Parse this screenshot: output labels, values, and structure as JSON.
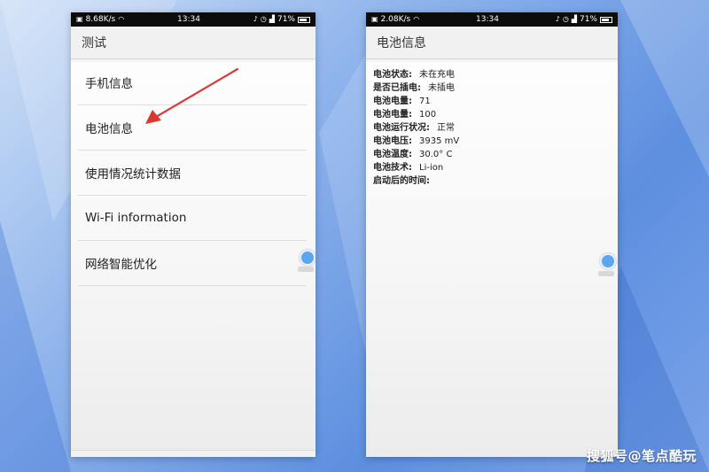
{
  "left_phone": {
    "status": {
      "speed": "8.68K/s",
      "time": "13:34",
      "battery": "71%"
    },
    "title": "测试",
    "menu": [
      {
        "label": "手机信息"
      },
      {
        "label": "电池信息"
      },
      {
        "label": "使用情况统计数据"
      },
      {
        "label": "Wi-Fi information"
      },
      {
        "label": "网络智能优化"
      }
    ]
  },
  "right_phone": {
    "status": {
      "speed": "2.08K/s",
      "time": "13:34",
      "battery": "71%"
    },
    "title": "电池信息",
    "info": [
      {
        "key": "电池状态:",
        "value": "未在充电"
      },
      {
        "key": "是否已插电:",
        "value": "未插电"
      },
      {
        "key": "电池电量:",
        "value": "71"
      },
      {
        "key": "电池电量:",
        "value": "100"
      },
      {
        "key": "电池运行状况:",
        "value": "正常"
      },
      {
        "key": "电池电压:",
        "value": "3935 mV"
      },
      {
        "key": "电池温度:",
        "value": "30.0° C"
      },
      {
        "key": "电池技术:",
        "value": "Li-ion"
      },
      {
        "key": "启动后的时间:",
        "value": ""
      }
    ]
  },
  "watermark": "搜狐号@笔点酷玩",
  "battery_level": 0.71,
  "colors": {
    "accent_arrow": "#d83a32",
    "floating_ball": "#5aa7f0"
  }
}
